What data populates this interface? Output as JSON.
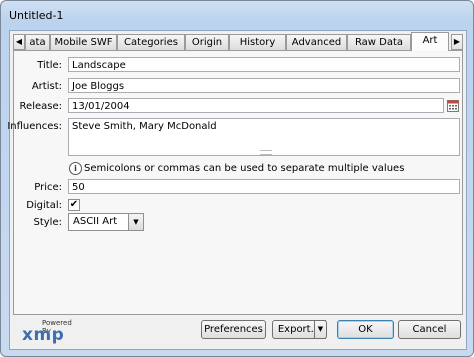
{
  "window": {
    "title": "Untitled-1"
  },
  "tabs": [
    {
      "label": "ata"
    },
    {
      "label": "Mobile SWF"
    },
    {
      "label": "Categories"
    },
    {
      "label": "Origin"
    },
    {
      "label": "History"
    },
    {
      "label": "Advanced"
    },
    {
      "label": "Raw Data"
    },
    {
      "label": "Art",
      "active": true
    }
  ],
  "tab_scroll": {
    "left": "◀",
    "right": "▶"
  },
  "form": {
    "title": {
      "label": "Title:",
      "value": "Landscape"
    },
    "artist": {
      "label": "Artist:",
      "value": "Joe Bloggs"
    },
    "release": {
      "label": "Release:",
      "value": "13/01/2004"
    },
    "influences": {
      "label": "Influences:",
      "value": "Steve Smith, Mary McDonald"
    },
    "hint": {
      "icon": "i",
      "text": "Semicolons or commas can be used to separate multiple values"
    },
    "price": {
      "label": "Price:",
      "value": "50"
    },
    "digital": {
      "label": "Digital:",
      "checked": true,
      "mark": "✔"
    },
    "style": {
      "label": "Style:",
      "value": "ASCII Art",
      "arrow": "▼"
    }
  },
  "footer": {
    "logo_small": "Powered By",
    "logo_big": "xmp",
    "preferences": "Preferences",
    "export": "Export...",
    "export_arrow": "▼",
    "ok": "OK",
    "cancel": "Cancel"
  },
  "colors": {
    "accent": "#3d6db3",
    "titlebar": "#bcd3ee"
  }
}
